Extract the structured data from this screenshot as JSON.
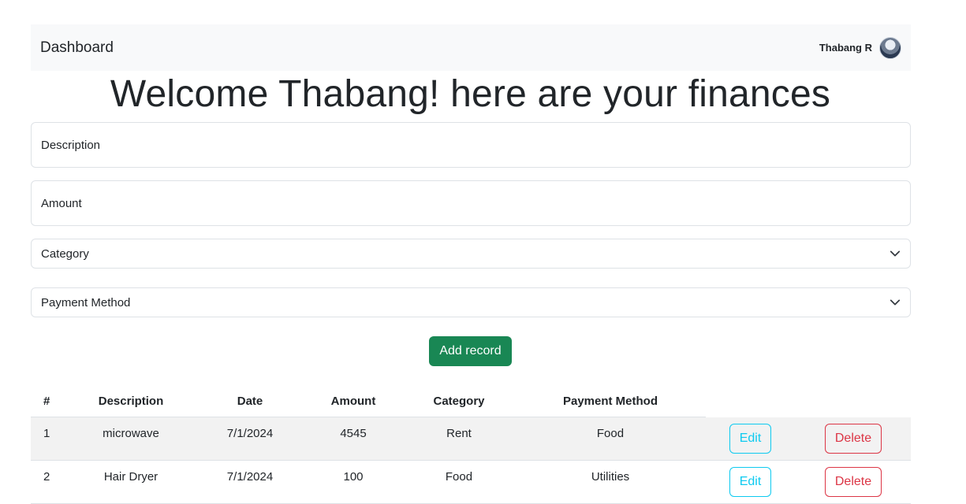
{
  "navbar": {
    "brand": "Dashboard",
    "user_name": "Thabang R"
  },
  "welcome": "Welcome Thabang! here are your finances",
  "form": {
    "description_placeholder": "Description",
    "amount_placeholder": "Amount",
    "category_placeholder": "Category",
    "payment_method_placeholder": "Payment Method",
    "submit_label": "Add record"
  },
  "table": {
    "headers": [
      "#",
      "Description",
      "Date",
      "Amount",
      "Category",
      "Payment Method"
    ],
    "rows": [
      {
        "num": "1",
        "description": "microwave",
        "date": "7/1/2024",
        "amount": "4545",
        "category": "Rent",
        "payment_method": "Food",
        "edit": "Edit",
        "delete": "Delete"
      },
      {
        "num": "2",
        "description": "Hair Dryer",
        "date": "7/1/2024",
        "amount": "100",
        "category": "Food",
        "payment_method": "Utilities",
        "edit": "Edit",
        "delete": "Delete"
      }
    ]
  },
  "colors": {
    "primary_action": "#198754",
    "edit": "#0dcaf0",
    "delete": "#dc3545"
  }
}
